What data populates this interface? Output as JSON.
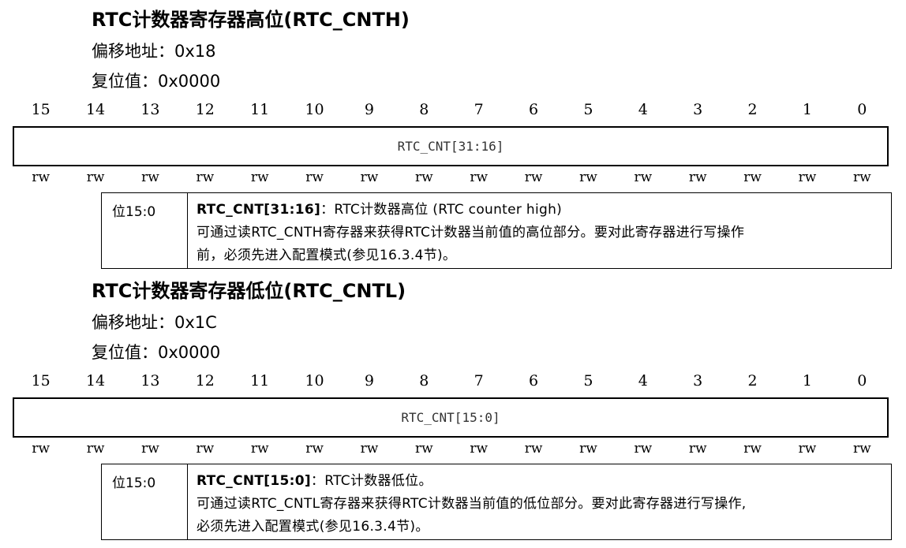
{
  "bit_positions": [
    "15",
    "14",
    "13",
    "12",
    "11",
    "10",
    "9",
    "8",
    "7",
    "6",
    "5",
    "4",
    "3",
    "2",
    "1",
    "0"
  ],
  "access": [
    "rw",
    "rw",
    "rw",
    "rw",
    "rw",
    "rw",
    "rw",
    "rw",
    "rw",
    "rw",
    "rw",
    "rw",
    "rw",
    "rw",
    "rw",
    "rw"
  ],
  "cnth": {
    "title": "RTC计数器寄存器高位(RTC_CNTH)",
    "offset": "偏移地址：0x18",
    "reset": "复位值：0x0000",
    "field_box": "RTC_CNT[31:16]",
    "bit_range": "位15:0",
    "field_name": "RTC_CNT[31:16]",
    "field_summary": "：RTC计数器高位 (RTC counter high)",
    "line1": "可通过读RTC_CNTH寄存器来获得RTC计数器当前值的高位部分。要对此寄存器进行写操作",
    "line2": "前，必须先进入配置模式(参见16.3.4节)。"
  },
  "cntl": {
    "title": "RTC计数器寄存器低位(RTC_CNTL)",
    "offset": "偏移地址：0x1C",
    "reset": "复位值：0x0000",
    "field_box": "RTC_CNT[15:0]",
    "bit_range": "位15:0",
    "field_name": "RTC_CNT[15:0]",
    "field_summary": "：RTC计数器低位。",
    "line1": "可通过读RTC_CNTL寄存器来获得RTC计数器当前值的低位部分。要对此寄存器进行写操作,",
    "line2": "必须先进入配置模式(参见16.3.4节)。"
  }
}
